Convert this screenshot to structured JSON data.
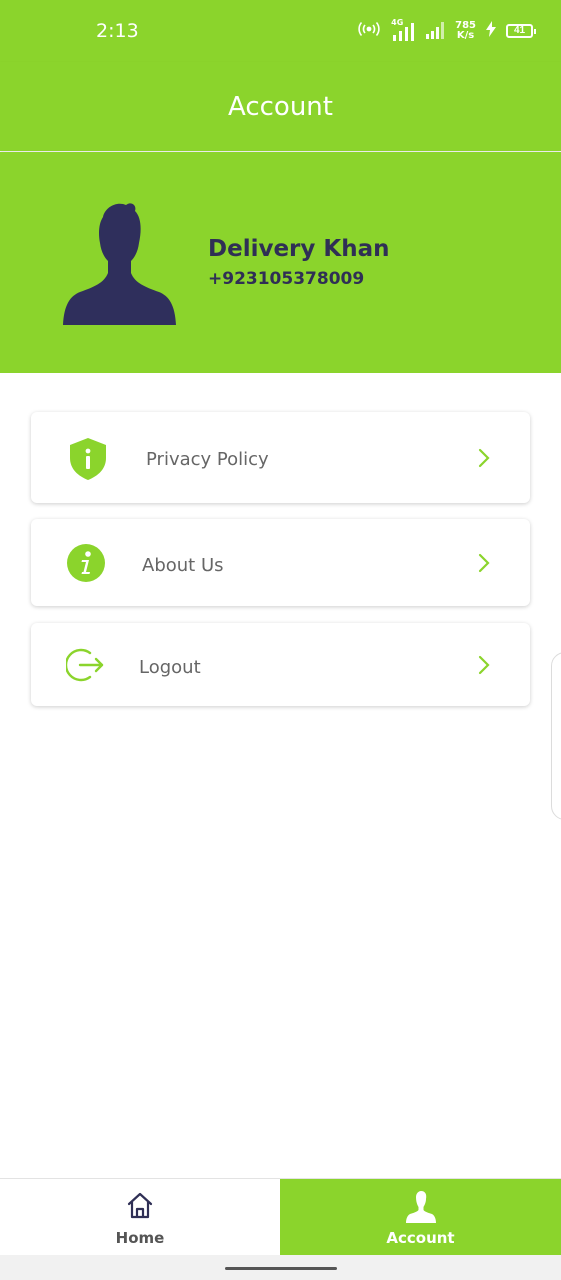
{
  "status_bar": {
    "time": "2:13",
    "network_type": "4G",
    "speed_value": "785",
    "speed_unit": "K/s",
    "battery": "41"
  },
  "header": {
    "title": "Account"
  },
  "profile": {
    "name": "Delivery Khan",
    "phone": "+923105378009",
    "avatar_icon": "user-silhouette-icon"
  },
  "menu": [
    {
      "label": "Privacy Policy",
      "icon": "shield-info-icon"
    },
    {
      "label": "About Us",
      "icon": "info-circle-icon"
    },
    {
      "label": "Logout",
      "icon": "logout-icon"
    }
  ],
  "bottom_nav": {
    "home_label": "Home",
    "account_label": "Account",
    "active": "Account"
  },
  "colors": {
    "primary": "#8bd42c",
    "dark_text": "#2f2f55",
    "muted_text": "#666666",
    "background": "#ffffff"
  }
}
